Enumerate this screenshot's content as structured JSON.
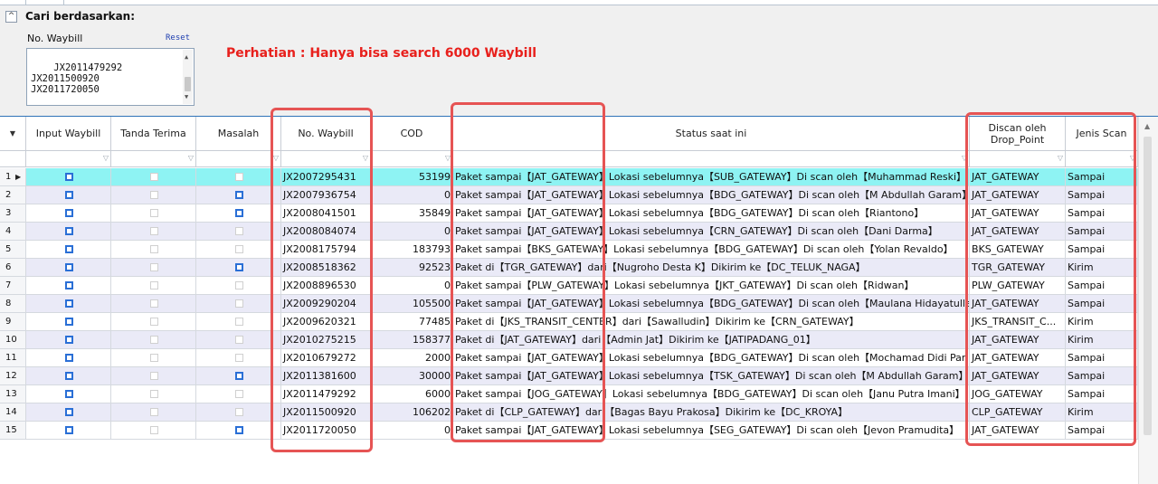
{
  "search": {
    "title": "Cari berdasarkan:",
    "waybill_label": "No. Waybill",
    "reset_label": "Reset",
    "waybill_input_value": "JX2011479292\nJX2011500920\nJX2011720050\n",
    "notice": "Perhatian : Hanya bisa search 6000 Waybill"
  },
  "grid": {
    "headers": {
      "input_waybill": "Input Waybill",
      "tanda_terima": "Tanda Terima",
      "masalah": "Masalah",
      "no_waybill": "No. Waybill",
      "cod": "COD",
      "status": "Status saat ini",
      "discan_oleh": "Discan oleh Drop_Point",
      "jenis_scan": "Jenis Scan"
    },
    "rows": [
      {
        "n": "1",
        "waybill": "JX2007295431",
        "cod": "53199",
        "status": "Paket sampai【JAT_GATEWAY】Lokasi sebelumnya【SUB_GATEWAY】Di scan oleh【Muhammad Reski】",
        "discan": "JAT_GATEWAY",
        "jenis": "Sampai",
        "input": true,
        "tanda": false,
        "masalah": false
      },
      {
        "n": "2",
        "waybill": "JX2007936754",
        "cod": "0",
        "status": "Paket sampai【JAT_GATEWAY】Lokasi sebelumnya【BDG_GATEWAY】Di scan oleh【M Abdullah Garam】",
        "discan": "JAT_GATEWAY",
        "jenis": "Sampai",
        "input": true,
        "tanda": false,
        "masalah": true
      },
      {
        "n": "3",
        "waybill": "JX2008041501",
        "cod": "35849",
        "status": "Paket sampai【JAT_GATEWAY】Lokasi sebelumnya【BDG_GATEWAY】Di scan oleh【Riantono】",
        "discan": "JAT_GATEWAY",
        "jenis": "Sampai",
        "input": true,
        "tanda": false,
        "masalah": true
      },
      {
        "n": "4",
        "waybill": "JX2008084074",
        "cod": "0",
        "status": "Paket sampai【JAT_GATEWAY】Lokasi sebelumnya【CRN_GATEWAY】Di scan oleh【Dani Darma】",
        "discan": "JAT_GATEWAY",
        "jenis": "Sampai",
        "input": true,
        "tanda": false,
        "masalah": false
      },
      {
        "n": "5",
        "waybill": "JX2008175794",
        "cod": "183793",
        "status": "Paket sampai【BKS_GATEWAY】Lokasi sebelumnya【BDG_GATEWAY】Di scan oleh【Yolan Revaldo】",
        "discan": "BKS_GATEWAY",
        "jenis": "Sampai",
        "input": true,
        "tanda": false,
        "masalah": false
      },
      {
        "n": "6",
        "waybill": "JX2008518362",
        "cod": "92523",
        "status": "Paket di【TGR_GATEWAY】dari【Nugroho Desta K】Dikirim ke【DC_TELUK_NAGA】",
        "discan": "TGR_GATEWAY",
        "jenis": "Kirim",
        "input": true,
        "tanda": false,
        "masalah": true
      },
      {
        "n": "7",
        "waybill": "JX2008896530",
        "cod": "0",
        "status": "Paket sampai【PLW_GATEWAY】Lokasi sebelumnya【JKT_GATEWAY】Di scan oleh【Ridwan】",
        "discan": "PLW_GATEWAY",
        "jenis": "Sampai",
        "input": true,
        "tanda": false,
        "masalah": false
      },
      {
        "n": "8",
        "waybill": "JX2009290204",
        "cod": "105500",
        "status": "Paket sampai【JAT_GATEWAY】Lokasi sebelumnya【BDG_GATEWAY】Di scan oleh【Maulana Hidayatullah】",
        "discan": "JAT_GATEWAY",
        "jenis": "Sampai",
        "input": true,
        "tanda": false,
        "masalah": false
      },
      {
        "n": "9",
        "waybill": "JX2009620321",
        "cod": "77485",
        "status": "Paket di【JKS_TRANSIT_CENTER】dari【Sawalludin】Dikirim ke【CRN_GATEWAY】",
        "discan": "JKS_TRANSIT_C...",
        "jenis": "Kirim",
        "input": true,
        "tanda": false,
        "masalah": false
      },
      {
        "n": "10",
        "waybill": "JX2010275215",
        "cod": "158377",
        "status": "Paket di【JAT_GATEWAY】dari【Admin Jat】Dikirim ke【JATIPADANG_01】",
        "discan": "JAT_GATEWAY",
        "jenis": "Kirim",
        "input": true,
        "tanda": false,
        "masalah": false
      },
      {
        "n": "11",
        "waybill": "JX2010679272",
        "cod": "2000",
        "status": "Paket sampai【JAT_GATEWAY】Lokasi sebelumnya【BDG_GATEWAY】Di scan oleh【Mochamad Didi Parian】",
        "discan": "JAT_GATEWAY",
        "jenis": "Sampai",
        "input": true,
        "tanda": false,
        "masalah": false
      },
      {
        "n": "12",
        "waybill": "JX2011381600",
        "cod": "30000",
        "status": "Paket sampai【JAT_GATEWAY】Lokasi sebelumnya【TSK_GATEWAY】Di scan oleh【M Abdullah Garam】",
        "discan": "JAT_GATEWAY",
        "jenis": "Sampai",
        "input": true,
        "tanda": false,
        "masalah": true
      },
      {
        "n": "13",
        "waybill": "JX2011479292",
        "cod": "6000",
        "status": "Paket sampai【JOG_GATEWAY】Lokasi sebelumnya【BDG_GATEWAY】Di scan oleh【Janu Putra Imani】",
        "discan": "JOG_GATEWAY",
        "jenis": "Sampai",
        "input": true,
        "tanda": false,
        "masalah": false
      },
      {
        "n": "14",
        "waybill": "JX2011500920",
        "cod": "106202",
        "status": "Paket di【CLP_GATEWAY】dari【Bagas Bayu Prakosa】Dikirim ke【DC_KROYA】",
        "discan": "CLP_GATEWAY",
        "jenis": "Kirim",
        "input": true,
        "tanda": false,
        "masalah": false
      },
      {
        "n": "15",
        "waybill": "JX2011720050",
        "cod": "0",
        "status": "Paket sampai【JAT_GATEWAY】Lokasi sebelumnya【SEG_GATEWAY】Di scan oleh【Jevon Pramudita】",
        "discan": "JAT_GATEWAY",
        "jenis": "Sampai",
        "input": true,
        "tanda": false,
        "masalah": true
      }
    ]
  },
  "colors": {
    "selected_row": "#8ef3f3",
    "alt_row": "#eaeaf7",
    "highlight_box": "#e65454",
    "notice_text": "#e8201c",
    "checkbox_on": "#2a6fd6"
  }
}
